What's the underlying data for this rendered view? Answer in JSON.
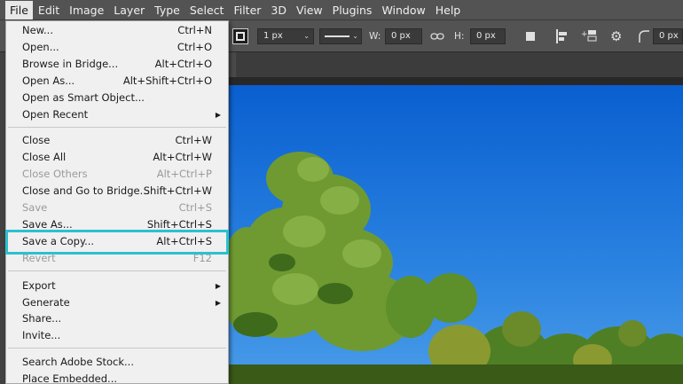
{
  "menubar": {
    "items": [
      "File",
      "Edit",
      "Image",
      "Layer",
      "Type",
      "Select",
      "Filter",
      "3D",
      "View",
      "Plugins",
      "Window",
      "Help"
    ]
  },
  "options": {
    "stroke_width": "1 px",
    "w_label": "W:",
    "w_value": "0 px",
    "h_label": "H:",
    "h_value": "0 px",
    "radius_value": "0 px"
  },
  "file_menu": {
    "items": [
      {
        "label": "New...",
        "shortcut": "Ctrl+N"
      },
      {
        "label": "Open...",
        "shortcut": "Ctrl+O"
      },
      {
        "label": "Browse in Bridge...",
        "shortcut": "Alt+Ctrl+O"
      },
      {
        "label": "Open As...",
        "shortcut": "Alt+Shift+Ctrl+O"
      },
      {
        "label": "Open as Smart Object...",
        "shortcut": ""
      },
      {
        "label": "Open Recent",
        "shortcut": ""
      },
      {
        "label": "Close",
        "shortcut": "Ctrl+W"
      },
      {
        "label": "Close All",
        "shortcut": "Alt+Ctrl+W"
      },
      {
        "label": "Close Others",
        "shortcut": "Alt+Ctrl+P"
      },
      {
        "label": "Close and Go to Bridge...",
        "shortcut": "Shift+Ctrl+W"
      },
      {
        "label": "Save",
        "shortcut": "Ctrl+S"
      },
      {
        "label": "Save As...",
        "shortcut": "Shift+Ctrl+S"
      },
      {
        "label": "Save a Copy...",
        "shortcut": "Alt+Ctrl+S"
      },
      {
        "label": "Revert",
        "shortcut": "F12"
      },
      {
        "label": "Export",
        "shortcut": ""
      },
      {
        "label": "Generate",
        "shortcut": ""
      },
      {
        "label": "Share...",
        "shortcut": ""
      },
      {
        "label": "Invite...",
        "shortcut": ""
      },
      {
        "label": "Search Adobe Stock...",
        "shortcut": ""
      },
      {
        "label": "Place Embedded...",
        "shortcut": ""
      }
    ]
  },
  "colors": {
    "highlight": "#2cc0d0",
    "menubar_bg": "#535353",
    "menu_bg": "#f0f0f0",
    "sky": "#1b6fd0"
  }
}
